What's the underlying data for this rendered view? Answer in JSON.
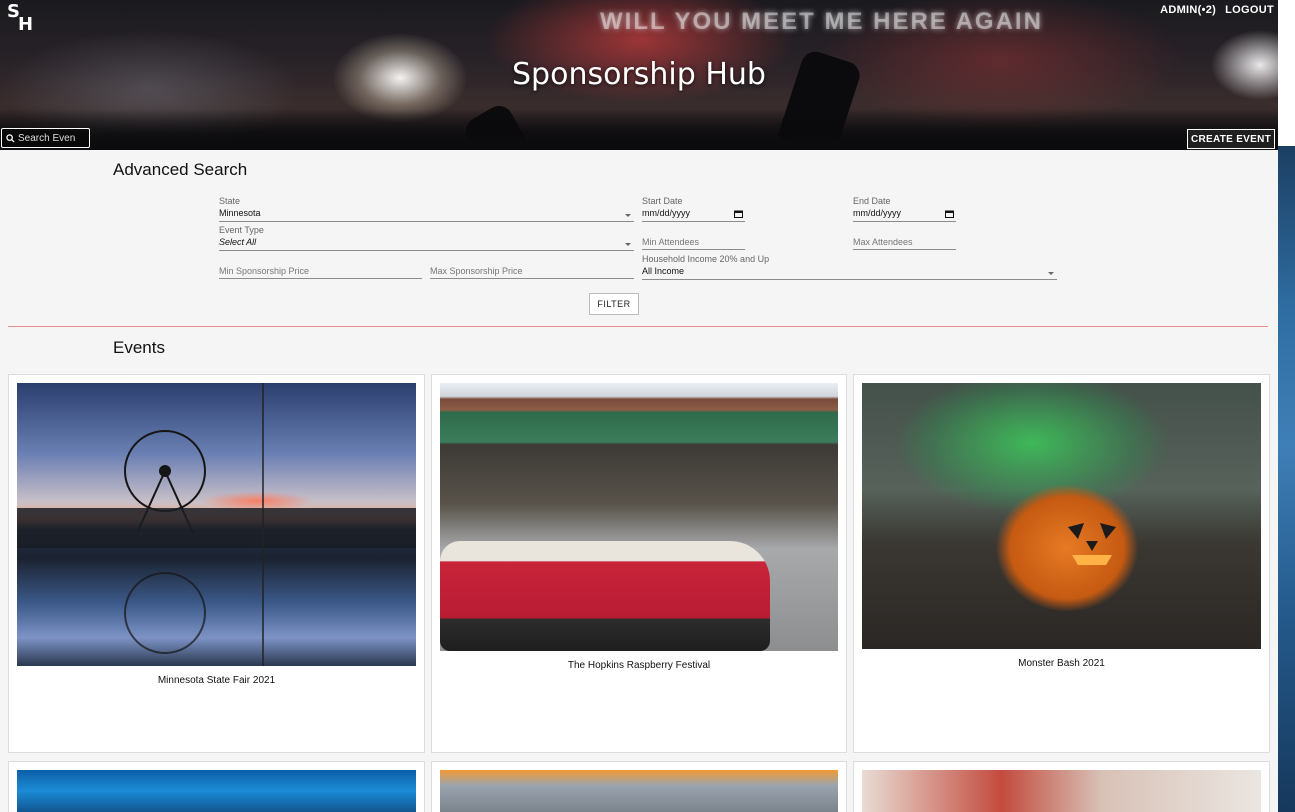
{
  "header": {
    "logo_line1": "S",
    "logo_line2": "H",
    "title": "Sponsorship Hub",
    "banner_text": "WILL YOU MEET ME HERE AGAIN",
    "nav": {
      "admin_label": "ADMIN(•2)",
      "logout_label": "LOGOUT"
    },
    "search": {
      "placeholder": "Search Even",
      "icon": "search-icon"
    },
    "create_event_label": "CREATE EVENT"
  },
  "advanced_search": {
    "title": "Advanced Search",
    "state": {
      "label": "State",
      "value": "Minnesota"
    },
    "start_date": {
      "label": "Start Date",
      "value": "mm/dd/yyyy"
    },
    "end_date": {
      "label": "End Date",
      "value": "mm/dd/yyyy"
    },
    "event_type": {
      "label": "Event Type",
      "value": "Select All"
    },
    "min_attendees": {
      "placeholder": "Min Attendees"
    },
    "max_attendees": {
      "placeholder": "Max Attendees"
    },
    "min_price": {
      "placeholder": "Min Sponsorship Price"
    },
    "max_price": {
      "placeholder": "Max Sponsorship Price"
    },
    "household_income": {
      "label": "Household Income 20% and Up",
      "value": "All Income"
    },
    "filter_label": "FILTER"
  },
  "events": {
    "title": "Events",
    "cards": [
      {
        "name": "Minnesota State Fair 2021"
      },
      {
        "name": "The Hopkins Raspberry Festival"
      },
      {
        "name": "Monster Bash 2021"
      },
      {
        "name": ""
      },
      {
        "name": ""
      },
      {
        "name": ""
      }
    ]
  },
  "colors": {
    "divider": "#e88e8e",
    "page_bg": "#f5f5f5",
    "card_border": "#dcdcdc"
  }
}
